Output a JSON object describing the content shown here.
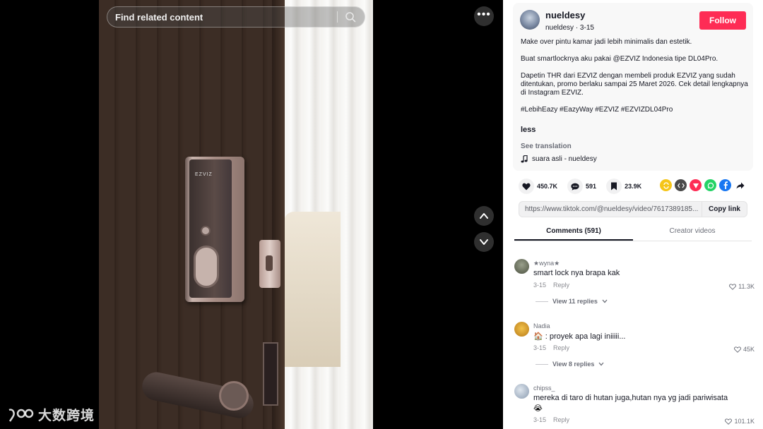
{
  "search": {
    "placeholder": "Find related content"
  },
  "video": {
    "lock_brand": "EZVIZ"
  },
  "watermark": {
    "text": "大数跨境"
  },
  "author": {
    "display_name": "nueldesy",
    "handle": "nueldesy",
    "date": "3-15",
    "follow_label": "Follow"
  },
  "description": {
    "paragraphs": [
      "Make over pintu kamar jadi lebih minimalis dan estetik.",
      "Buat smartlocknya aku pakai @EZVIZ Indonesia tipe DL04Pro.",
      "Dapetin THR dari EZVIZ dengan membeli produk EZVIZ yang sudah ditentukan, promo berlaku sampai 25 Maret 2026. Cek detail lengkapnya di Instagram EZVIZ.",
      "#LebihEazy #EazyWay #EZVIZ #EZVIZDL04Pro"
    ],
    "less_label": "less",
    "see_translation": "See translation",
    "music": "suara asli - nueldesy"
  },
  "actions": {
    "likes": "450.7K",
    "comments": "591",
    "saves": "23.9K"
  },
  "share_icons": [
    {
      "name": "repost-icon",
      "color": "#f5c518"
    },
    {
      "name": "embed-icon",
      "color": "#4a4a4a"
    },
    {
      "name": "send-icon",
      "color": "#fe2c55"
    },
    {
      "name": "whatsapp-icon",
      "color": "#25d366"
    },
    {
      "name": "facebook-icon",
      "color": "#1877f2"
    },
    {
      "name": "share-arrow-icon",
      "color": "#161823"
    }
  ],
  "link": {
    "url": "https://www.tiktok.com/@nueldesy/video/7617389185...",
    "copy_label": "Copy link"
  },
  "tabs": [
    {
      "label": "Comments (591)",
      "active": true
    },
    {
      "label": "Creator videos",
      "active": false
    }
  ],
  "comments": [
    {
      "user": "★wyna★",
      "text": "smart lock nya brapa kak",
      "date": "3-15",
      "reply": "Reply",
      "likes": "11.3K",
      "replies": "View 11 replies"
    },
    {
      "user": "Nadia",
      "text": ": proyek apa lagi iniiiii...",
      "date": "3-15",
      "reply": "Reply",
      "likes": "45K",
      "replies": "View 8 replies"
    },
    {
      "user": "chipss_",
      "text": "mereka di taro di hutan juga,hutan nya yg jadi pariwisata",
      "date": "3-15",
      "reply": "Reply",
      "likes": "101.1K"
    }
  ]
}
